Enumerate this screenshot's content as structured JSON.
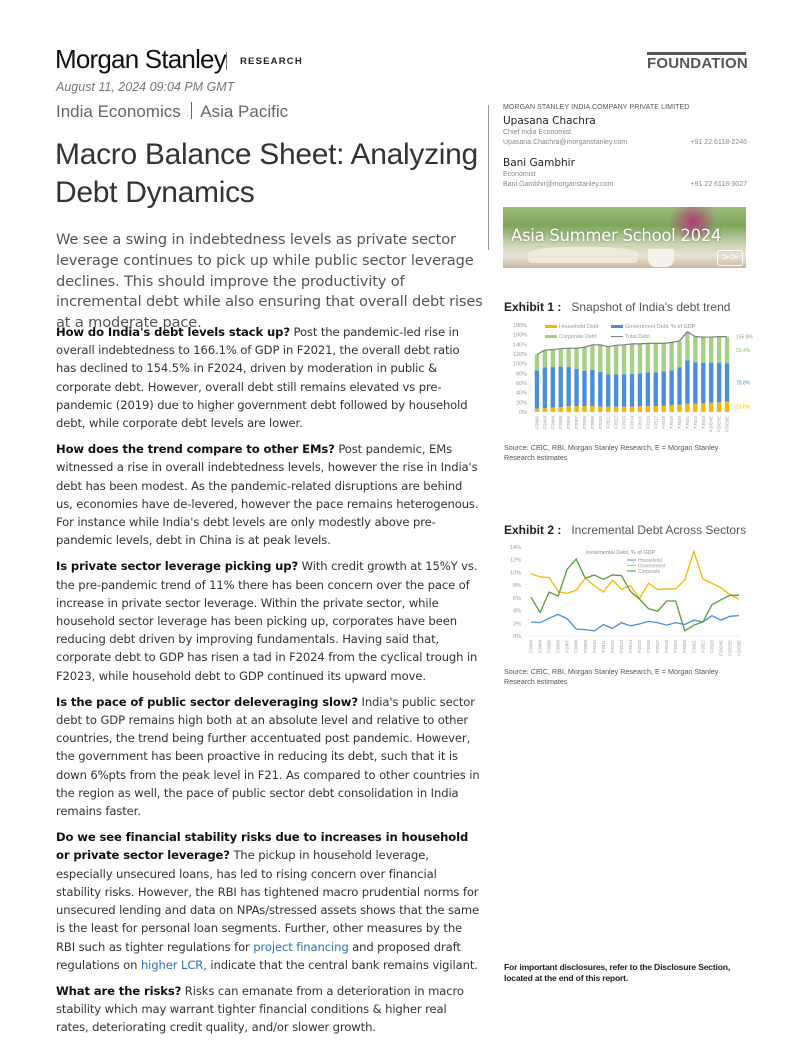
{
  "header": {
    "brand": "Morgan Stanley",
    "division": "RESEARCH",
    "series": "FOUNDATION",
    "date": "August 11, 2024 09:04 PM GMT",
    "category_primary": "India Economics",
    "category_secondary": "Asia Pacific"
  },
  "report": {
    "title": "Macro Balance Sheet: Analyzing Debt Dynamics",
    "summary": "We see a swing in indebtedness levels as private sector leverage continues to pick up while public sector leverage declines. This should improve the productivity of incremental debt while also ensuring that overall debt rises at a moderate pace.",
    "sections": [
      {
        "heading": "How do India's debt levels stack up?",
        "text": " Post the pandemic-led rise in overall indebtedness to 166.1% of GDP in F2021, the overall debt ratio has declined to 154.5% in F2024, driven by moderation in public & corporate debt. However, overall debt still remains elevated vs pre-pandemic (2019) due to higher government debt followed by household debt, while corporate debt levels are lower."
      },
      {
        "heading": "How does the trend compare to other EMs?",
        "text": " Post pandemic, EMs witnessed a rise in overall indebtedness levels, however the rise in India's debt has been modest. As the pandemic-related disruptions are behind us, economies have de-levered, however the pace remains heterogenous. For instance while India's debt levels are only modestly above pre-pandemic levels, debt in China is at peak levels."
      },
      {
        "heading": "Is private sector leverage picking up?",
        "text": " With credit growth at 15%Y vs. the pre-pandemic trend of 11% there has been concern over the pace of increase in private sector leverage. Within the private sector, while household sector leverage has been picking up, corporates have been reducing debt driven by improving fundamentals. Having said that, corporate debt to GDP has risen a tad in F2024 from the cyclical trough in F2023, while household debt to GDP continued its upward move."
      },
      {
        "heading": "Is the pace of public sector deleveraging slow?",
        "text": " India's public sector debt to GDP remains high both at an absolute level and relative to other countries, the trend being further accentuated post pandemic. However, the government has been proactive in reducing its debt, such that it is down 6%pts from the peak level in F21. As compared to other countries in the region as well, the pace of public sector debt consolidation in India remains faster."
      },
      {
        "heading": "Do we see financial stability risks due to increases in household or private sector leverage?",
        "text_before": " The pickup in household leverage, especially unsecured loans, has led to rising concern over financial stability risks. However, the RBI has tightened macro prudential norms for unsecured lending and data on NPAs/stressed assets shows that the same is the least for personal loan segments. Further, other measures by the RBI such as tighter regulations for ",
        "link1": "project financing",
        "text_middle": " and proposed draft regulations on ",
        "link2": "higher LCR,",
        "text_after": " indicate that the central bank remains vigilant."
      },
      {
        "heading": "What are the risks?",
        "text": " Risks can emanate from a deterioration in macro stability which may warrant tighter financial conditions & higher real rates, deteriorating credit quality, and/or slower growth."
      }
    ]
  },
  "sidebar": {
    "company": "MORGAN STANLEY INDIA COMPANY PRIVATE LIMITED",
    "analysts": [
      {
        "name": "Upasana Chachra",
        "role": "Chief India Economist",
        "email": "Upasana.Chachra@morganstanley.com",
        "phone": "+91 22 6118-2246"
      },
      {
        "name": "Bani Gambhir",
        "role": "Economist",
        "email": "Bani.Gambhir@morganstanley.com",
        "phone": "+91 22 6118-3027"
      }
    ],
    "banner": {
      "text": "Asia Summer School 2024",
      "button": ">>"
    },
    "disclosure": "For important disclosures, refer to the Disclosure Section, located at the end of this report."
  },
  "exhibits": [
    {
      "label": "Exhibit 1 :",
      "title": "Snapshot of India's debt trend",
      "source": "Source: CEIC, RBI, Morgan Stanley Research, E = Morgan Stanley Research estimates"
    },
    {
      "label": "Exhibit 2 :",
      "title": "Incremental Debt Across Sectors",
      "source": "Source: CEIC, RBI, Morgan Stanley Research, E = Morgan Stanley Research estimates"
    }
  ],
  "chart_data": [
    {
      "type": "bar",
      "stacked": true,
      "title": "Snapshot of India's debt trend",
      "annotation": "% of GDP",
      "categories": [
        "F2002",
        "F2003",
        "F2004",
        "F2005",
        "F2006",
        "F2007",
        "F2008",
        "F2009",
        "F2010",
        "F2011",
        "F2012",
        "F2013",
        "F2014",
        "F2015",
        "F2016",
        "F2017",
        "F2018",
        "F2019",
        "F2020",
        "F2021",
        "F2022",
        "F2023",
        "F2024E",
        "F2025E",
        "F2026E"
      ],
      "series": [
        {
          "name": "Household Debt",
          "color": "#f5b800",
          "values": [
            7,
            8,
            9,
            10,
            12,
            12,
            12,
            12,
            11,
            11,
            11,
            11,
            11,
            12,
            12,
            12,
            13,
            14,
            15,
            17,
            17,
            18,
            19,
            20,
            22
          ]
        },
        {
          "name": "Government Debt",
          "color": "#4a8fd6",
          "values": [
            79,
            84,
            84,
            84,
            81,
            77,
            73,
            75,
            72,
            67,
            67,
            67,
            68,
            68,
            70,
            70,
            71,
            72,
            77,
            90,
            86,
            84,
            83,
            82,
            79
          ]
        },
        {
          "name": "Corporate Debt",
          "color": "#a6cf86",
          "values": [
            33,
            36,
            36,
            37,
            39,
            43,
            49,
            52,
            56,
            57,
            60,
            61,
            62,
            61,
            60,
            60,
            58,
            58,
            55,
            59,
            53,
            53,
            53,
            54,
            55
          ]
        },
        {
          "name": "Total Debt",
          "color": "#7f7f7f",
          "type": "line",
          "values": [
            119,
            128,
            129,
            131,
            132,
            132,
            134,
            139,
            139,
            135,
            138,
            139,
            141,
            141,
            142,
            142,
            142,
            144,
            147,
            166,
            156,
            155,
            155,
            156,
            156
          ]
        }
      ],
      "end_labels": [
        "155.8%",
        "53.4%",
        "78.8%",
        "23.6%"
      ],
      "ylim": [
        0,
        180
      ],
      "yticks": [
        "0%",
        "20%",
        "40%",
        "60%",
        "80%",
        "100%",
        "120%",
        "140%",
        "160%",
        "180%"
      ],
      "legend": "top"
    },
    {
      "type": "line",
      "title": "Incremental Debt Across Sectors",
      "legend_title": "Incremental Debt, % of GDP",
      "categories": [
        "F2003",
        "F2004",
        "F2005",
        "F2006",
        "F2007",
        "F2008",
        "F2009",
        "F2010",
        "F2011",
        "F2012",
        "F2013",
        "F2014",
        "F2015",
        "F2016",
        "F2017",
        "F2018",
        "F2019",
        "F2020",
        "F2021",
        "F2022",
        "F2023",
        "F2024E",
        "F2025E",
        "F2026E"
      ],
      "series": [
        {
          "name": "Household",
          "color": "#4a8fd6",
          "values": [
            2.2,
            2.1,
            2.8,
            3.4,
            2.7,
            1.1,
            1.0,
            0.8,
            1.8,
            1.2,
            2.1,
            1.6,
            1.9,
            2.3,
            2.1,
            1.7,
            2.1,
            1.8,
            2.5,
            2.2,
            3.2,
            2.5,
            3.1,
            3.2
          ]
        },
        {
          "name": "Government",
          "color": "#f5b800",
          "values": [
            9.8,
            9.3,
            9.2,
            7.0,
            6.7,
            7.2,
            9.1,
            7.9,
            6.9,
            8.8,
            7.4,
            7.9,
            5.9,
            8.3,
            7.3,
            7.4,
            7.4,
            8.8,
            13.3,
            9.0,
            8.3,
            7.6,
            6.5,
            5.8
          ]
        },
        {
          "name": "Corporate",
          "color": "#5a9a3c",
          "values": [
            6.1,
            3.7,
            6.9,
            6.3,
            10.5,
            12.1,
            9.1,
            9.6,
            8.9,
            9.6,
            9.5,
            7.0,
            5.8,
            4.3,
            3.9,
            5.5,
            5.5,
            0.8,
            1.7,
            2.2,
            4.9,
            5.7,
            6.4,
            6.4
          ]
        }
      ],
      "ylim": [
        0,
        14
      ],
      "yticks": [
        "0%",
        "2%",
        "4%",
        "6%",
        "8%",
        "10%",
        "12%",
        "14%"
      ],
      "legend": "top-center"
    }
  ]
}
